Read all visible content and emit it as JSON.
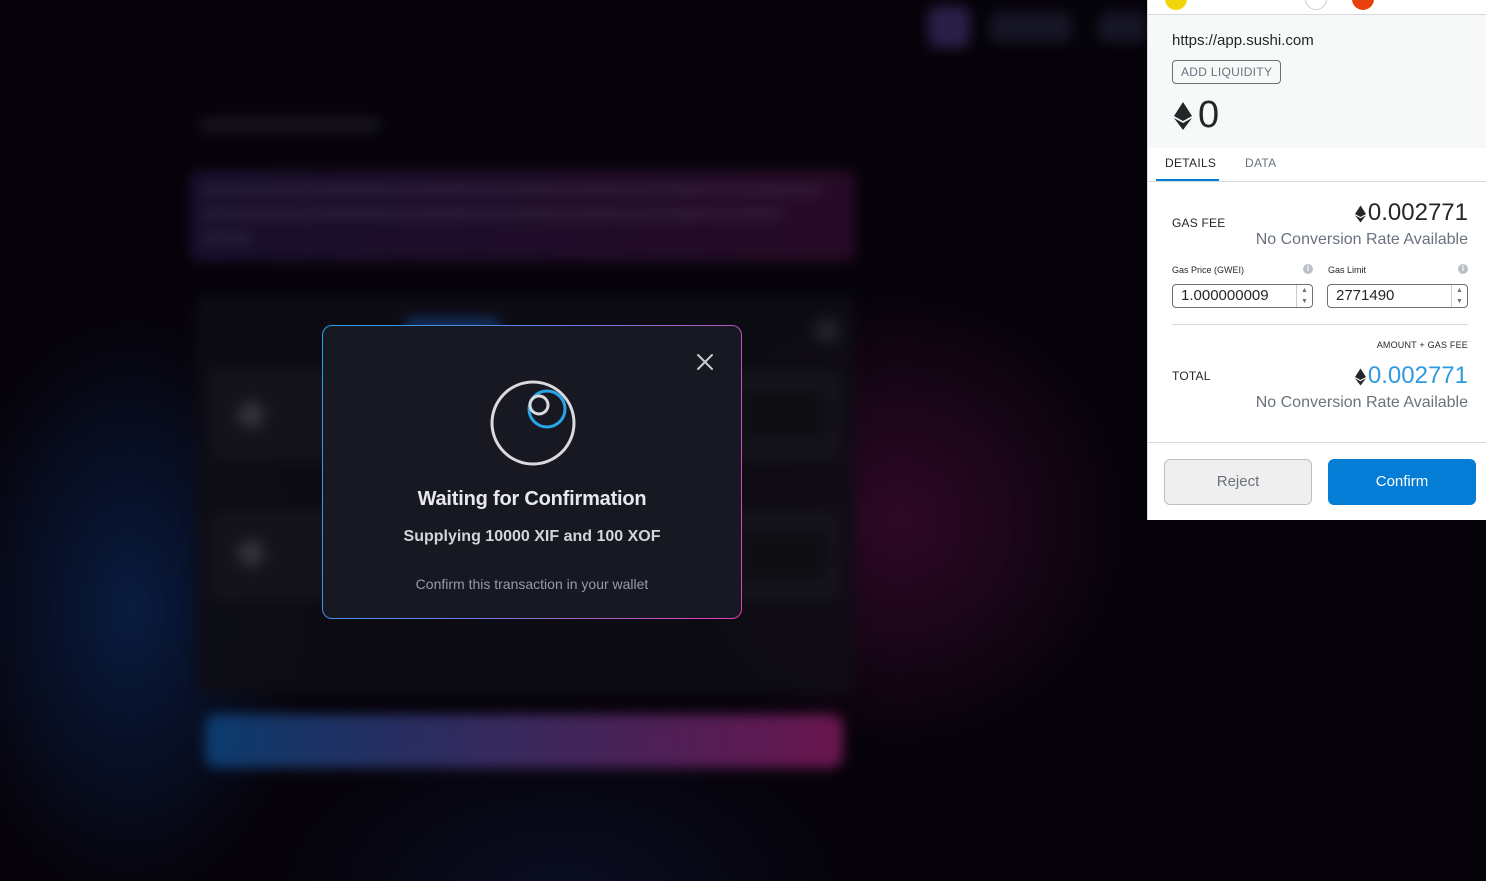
{
  "modal": {
    "title": "Waiting for Confirmation",
    "subtitle": "Supplying 10000 XIF and 100 XOF",
    "hint": "Confirm this transaction in your wallet"
  },
  "wallet": {
    "origin": "https://app.sushi.com",
    "method_badge": "ADD LIQUIDITY",
    "amount": "0",
    "tabs": [
      {
        "label": "DETAILS",
        "active": true
      },
      {
        "label": "DATA",
        "active": false
      }
    ],
    "gas_fee": {
      "label": "GAS FEE",
      "value": "0.002771",
      "conversion": "No Conversion Rate Available"
    },
    "gas_price": {
      "label": "Gas Price (GWEI)",
      "value": "1.000000009"
    },
    "gas_limit": {
      "label": "Gas Limit",
      "value": "2771490"
    },
    "amount_gas_fee_label": "AMOUNT + GAS FEE",
    "total": {
      "label": "TOTAL",
      "value": "0.002771",
      "conversion": "No Conversion Rate Available"
    },
    "buttons": {
      "reject": "Reject",
      "confirm": "Confirm"
    }
  },
  "colors": {
    "accent_blue": "#037dd6",
    "total_blue": "#2f9ae0",
    "modal_bg": "#171821",
    "gradient_start": "#1fa4e8",
    "gradient_end": "#e33fb4"
  }
}
